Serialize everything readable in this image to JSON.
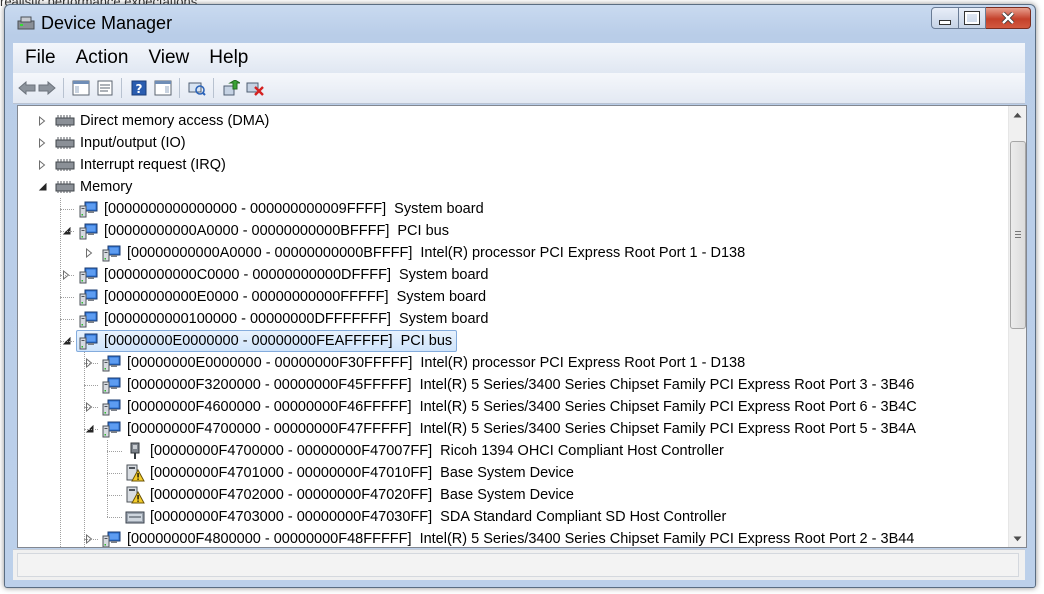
{
  "background": {
    "snippet": "realistic performance expectations"
  },
  "window": {
    "title": "Device Manager",
    "controls": [
      "minimize",
      "maximize",
      "close"
    ]
  },
  "menu": {
    "items": [
      "File",
      "Action",
      "View",
      "Help"
    ]
  },
  "toolbar": {
    "buttons": [
      "back-arrow-icon",
      "forward-arrow-icon",
      "show-hide-console-tree-icon",
      "properties-icon",
      "help-icon",
      "action-pane-icon",
      "scan-hardware-icon",
      "update-driver-icon",
      "uninstall-icon"
    ]
  },
  "tree": {
    "rows": [
      {
        "range": "",
        "label": "Direct memory access (DMA)",
        "expander": "collapsed",
        "icon": "resources-icon"
      },
      {
        "range": "",
        "label": "Input/output (IO)",
        "expander": "collapsed",
        "icon": "resources-icon"
      },
      {
        "range": "",
        "label": "Interrupt request (IRQ)",
        "expander": "collapsed",
        "icon": "resources-icon"
      },
      {
        "range": "",
        "label": "Memory",
        "expander": "expanded",
        "icon": "resources-icon"
      },
      {
        "range": "[0000000000000000 - 000000000009FFFF]",
        "label": "System board",
        "expander": "none",
        "icon": "computer-device-icon"
      },
      {
        "range": "[00000000000A0000 - 00000000000BFFFF]",
        "label": "PCI bus",
        "expander": "expanded",
        "icon": "computer-device-icon"
      },
      {
        "range": "[00000000000A0000 - 00000000000BFFFF]",
        "label": "Intel(R) processor PCI Express Root Port 1 - D138",
        "expander": "collapsed",
        "icon": "computer-device-icon"
      },
      {
        "range": "[00000000000C0000 - 00000000000DFFFF]",
        "label": "System board",
        "expander": "collapsed",
        "icon": "computer-device-icon"
      },
      {
        "range": "[00000000000E0000 - 00000000000FFFFF]",
        "label": "System board",
        "expander": "none",
        "icon": "computer-device-icon"
      },
      {
        "range": "[0000000000100000 - 00000000DFFFFFFF]",
        "label": "System board",
        "expander": "none",
        "icon": "computer-device-icon"
      },
      {
        "range": "[00000000E0000000 - 00000000FEAFFFFF]",
        "label": "PCI bus",
        "expander": "expanded",
        "icon": "computer-device-icon",
        "selected": true
      },
      {
        "range": "[00000000E0000000 - 00000000F30FFFFF]",
        "label": "Intel(R) processor PCI Express Root Port 1 - D138",
        "expander": "collapsed",
        "icon": "computer-device-icon"
      },
      {
        "range": "[00000000F3200000 - 00000000F45FFFFF]",
        "label": "Intel(R) 5 Series/3400 Series Chipset Family PCI Express Root Port 3 - 3B46",
        "expander": "none",
        "icon": "computer-device-icon"
      },
      {
        "range": "[00000000F4600000 - 00000000F46FFFFF]",
        "label": "Intel(R) 5 Series/3400 Series Chipset Family PCI Express Root Port 6 - 3B4C",
        "expander": "collapsed",
        "icon": "computer-device-icon"
      },
      {
        "range": "[00000000F4700000 - 00000000F47FFFFF]",
        "label": "Intel(R) 5 Series/3400 Series Chipset Family PCI Express Root Port 5 - 3B4A",
        "expander": "expanded",
        "icon": "computer-device-icon"
      },
      {
        "range": "[00000000F4700000 - 00000000F47007FF]",
        "label": "Ricoh 1394 OHCI Compliant Host Controller",
        "expander": "none",
        "icon": "firewire-icon"
      },
      {
        "range": "[00000000F4701000 - 00000000F47010FF]",
        "label": "Base System Device",
        "expander": "none",
        "icon": "unknown-device-warning-icon"
      },
      {
        "range": "[00000000F4702000 - 00000000F47020FF]",
        "label": "Base System Device",
        "expander": "none",
        "icon": "unknown-device-warning-icon"
      },
      {
        "range": "[00000000F4703000 - 00000000F47030FF]",
        "label": "SDA Standard Compliant SD Host Controller",
        "expander": "none",
        "icon": "sd-host-icon"
      },
      {
        "range": "[00000000F4800000 - 00000000F48FFFFF]",
        "label": "Intel(R) 5 Series/3400 Series Chipset Family PCI Express Root Port 2 - 3B44",
        "expander": "collapsed",
        "icon": "computer-device-icon"
      }
    ]
  },
  "status": {
    "text": ""
  }
}
